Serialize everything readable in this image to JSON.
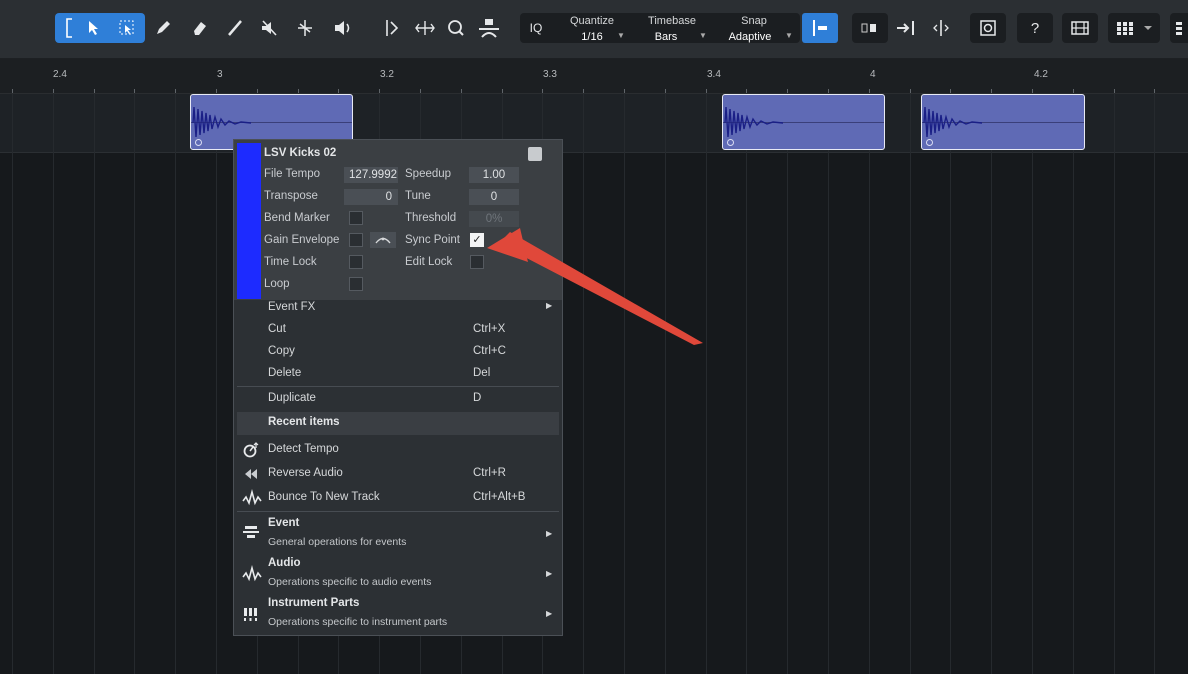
{
  "toolbar": {
    "quantize_label": "Quantize",
    "quantize_value": "1/16",
    "timebase_label": "Timebase",
    "timebase_value": "Bars",
    "snap_label": "Snap",
    "snap_value": "Adaptive",
    "iq_label": "IQ",
    "help_label": "?"
  },
  "ruler": {
    "labels": [
      "2.4",
      "3",
      "3.2",
      "3.3",
      "3.4",
      "4",
      "4.2"
    ]
  },
  "inspector": {
    "event_name": "LSV Kicks 02",
    "file_tempo_label": "File Tempo",
    "file_tempo_value": "127.9992",
    "speedup_label": "Speedup",
    "speedup_value": "1.00",
    "transpose_label": "Transpose",
    "transpose_value": "0",
    "tune_label": "Tune",
    "tune_value": "0",
    "bend_marker_label": "Bend Marker",
    "threshold_label": "Threshold",
    "threshold_value": "0%",
    "gain_envelope_label": "Gain Envelope",
    "sync_point_label": "Sync Point",
    "sync_point_checked": true,
    "time_lock_label": "Time Lock",
    "edit_lock_label": "Edit Lock",
    "loop_label": "Loop",
    "accent_color": "#1d2bff"
  },
  "menu": {
    "event_fx": "Event FX",
    "cut": "Cut",
    "cut_key": "Ctrl+X",
    "copy": "Copy",
    "copy_key": "Ctrl+C",
    "delete": "Delete",
    "delete_key": "Del",
    "duplicate": "Duplicate",
    "duplicate_key": "D",
    "recent_header": "Recent items",
    "detect_tempo": "Detect Tempo",
    "reverse_audio": "Reverse Audio",
    "reverse_audio_key": "Ctrl+R",
    "bounce": "Bounce To New Track",
    "bounce_key": "Ctrl+Alt+B",
    "event_title": "Event",
    "event_desc": "General operations for events",
    "audio_title": "Audio",
    "audio_desc": "Operations specific to audio events",
    "instrument_title": "Instrument Parts",
    "instrument_desc": "Operations specific to instrument parts"
  },
  "annotation": {
    "arrow_color": "#e0483a"
  }
}
